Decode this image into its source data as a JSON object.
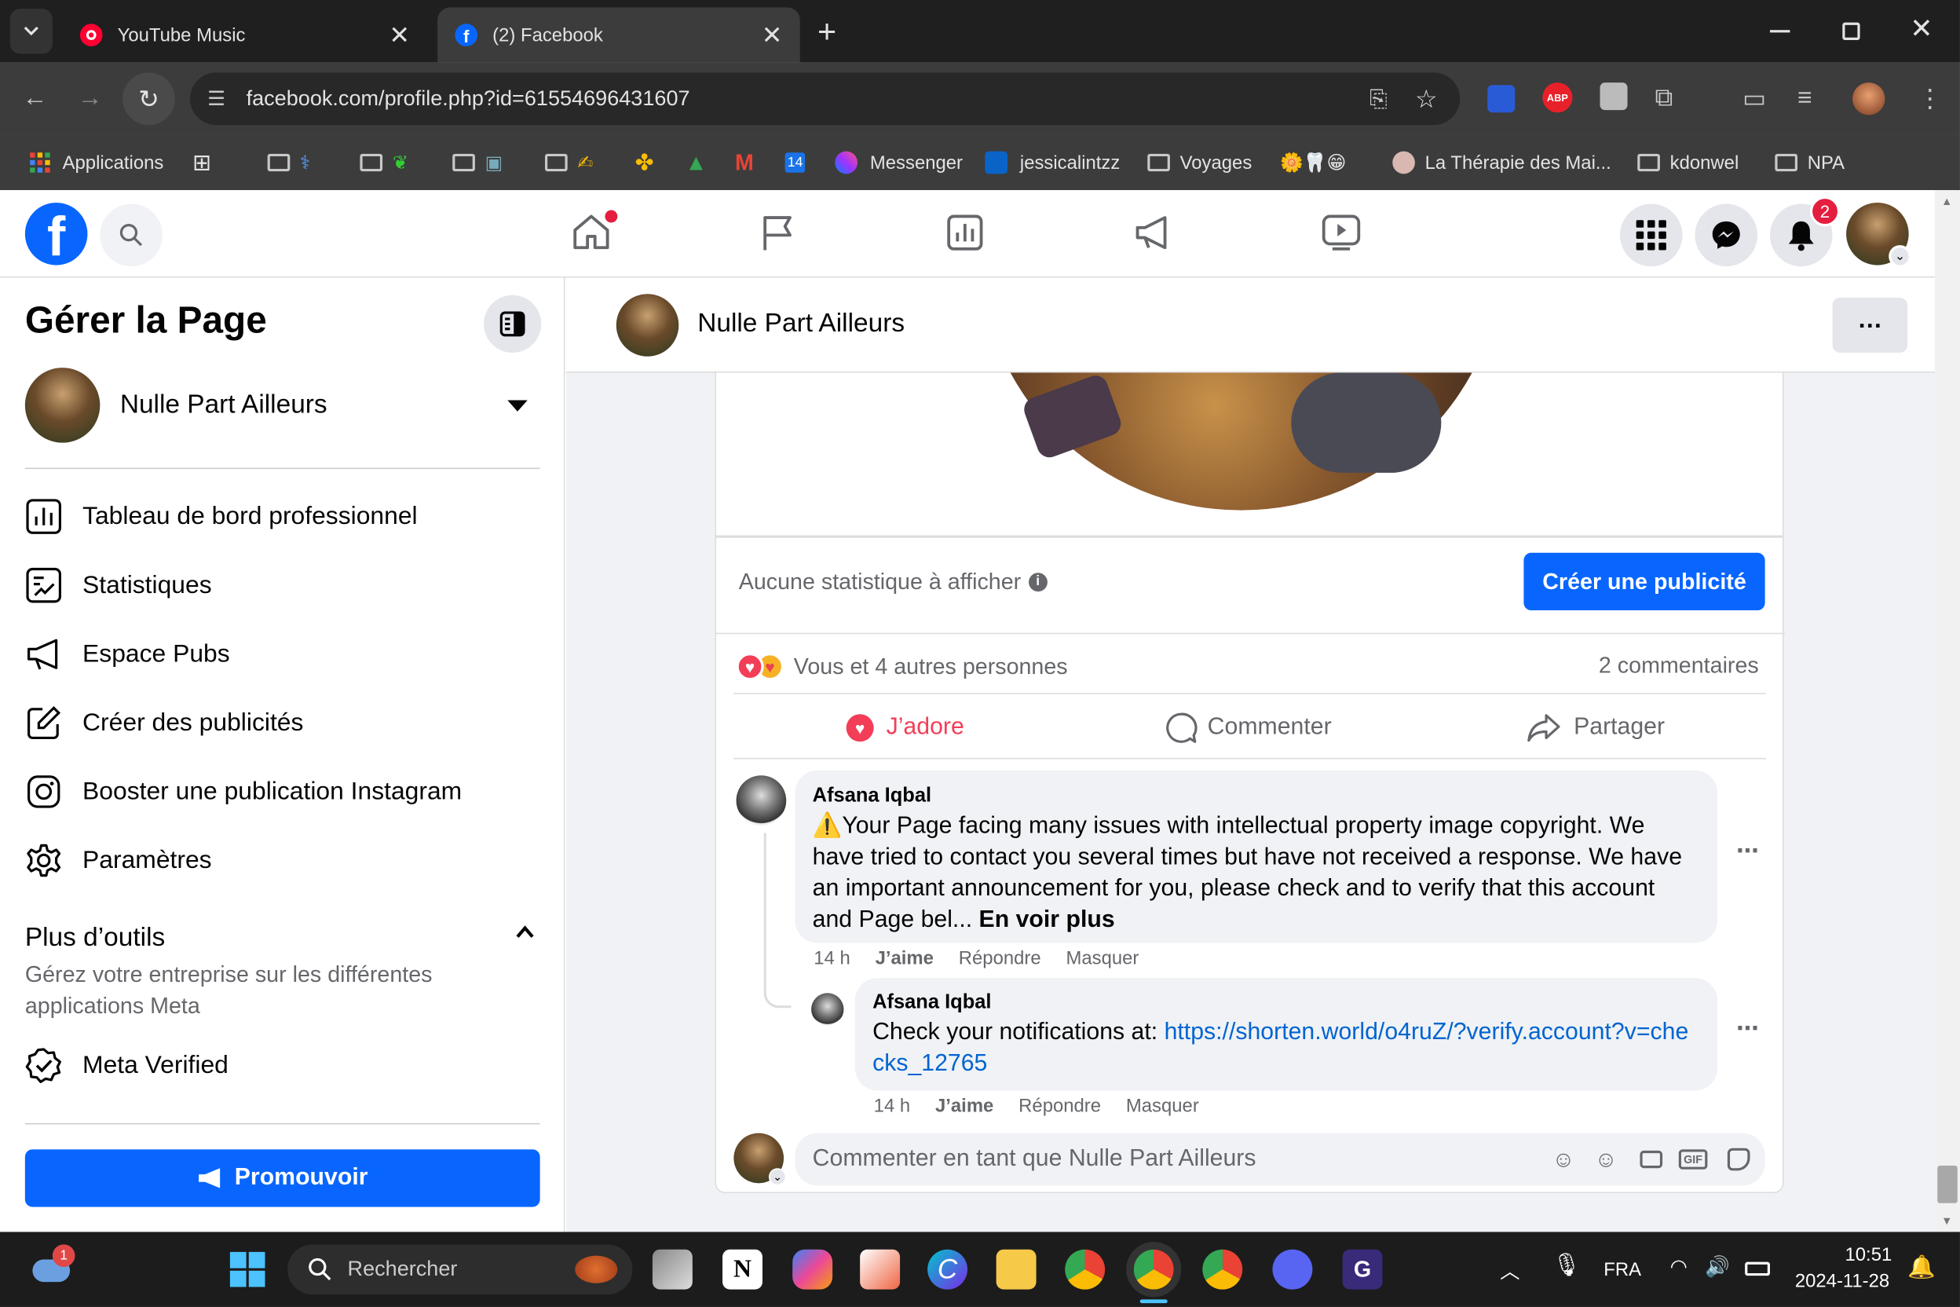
{
  "browser": {
    "tabs": [
      {
        "title": "YouTube Music",
        "active": false
      },
      {
        "title": "(2) Facebook",
        "active": true
      }
    ],
    "url": "facebook.com/profile.php?id=61554696431607",
    "bookmarks": [
      {
        "label": "Applications"
      },
      {
        "label": "Messenger"
      },
      {
        "label": "jessicalintzz"
      },
      {
        "label": "Voyages"
      },
      {
        "label": "La Thérapie des Mai..."
      },
      {
        "label": "kdonwel"
      },
      {
        "label": "NPA"
      }
    ],
    "calendar_badge": "14"
  },
  "fb": {
    "notification_count": "2",
    "left": {
      "title": "Gérer la Page",
      "page_name": "Nulle Part Ailleurs",
      "menu": [
        {
          "label": "Tableau de bord professionnel",
          "icon": "dashboard-icon"
        },
        {
          "label": "Statistiques",
          "icon": "insights-icon"
        },
        {
          "label": "Espace Pubs",
          "icon": "megaphone-icon"
        },
        {
          "label": "Créer des publicités",
          "icon": "edit-icon"
        },
        {
          "label": "Booster une publication Instagram",
          "icon": "instagram-icon"
        },
        {
          "label": "Paramètres",
          "icon": "gear-icon"
        }
      ],
      "more_tools_title": "Plus d’outils",
      "more_tools_desc": "Gérez votre entreprise sur les différentes applications Meta",
      "meta_verified": "Meta Verified",
      "promote_label": "Promouvoir"
    },
    "header_page_name": "Nulle Part Ailleurs",
    "post": {
      "no_stats": "Aucune statistique à afficher",
      "create_ad": "Créer une publicité",
      "reactions_text": "Vous et 4 autres personnes",
      "comments_count": "2 commentaires",
      "like": "J’adore",
      "comment": "Commenter",
      "share": "Partager"
    },
    "comments": [
      {
        "author": "Afsana Iqbal",
        "text": "⚠️Your Page facing many issues with intellectual property image copyright. We have tried to contact you several times but have not received a response. We have an important announcement for you, please check and to verify that this account and Page bel...",
        "see_more": "En voir plus",
        "time": "14 h",
        "like": "J’aime",
        "reply": "Répondre",
        "hide": "Masquer"
      },
      {
        "author": "Afsana Iqbal",
        "text_prefix": "Check your notifications at: ",
        "link": "https://shorten.world/o4ruZ/?verify.account?v=checks_12765",
        "time": "14 h",
        "like": "J’aime",
        "reply": "Répondre",
        "hide": "Masquer"
      }
    ],
    "comment_placeholder": "Commenter en tant que Nulle Part Ailleurs"
  },
  "taskbar": {
    "weather_badge": "1",
    "search_placeholder": "Rechercher",
    "language": "FRA",
    "time": "10:51",
    "date": "2024-11-28"
  },
  "colors": {
    "fb_blue": "#0866ff",
    "love_red": "#f33e58",
    "link": "#0064d1"
  }
}
